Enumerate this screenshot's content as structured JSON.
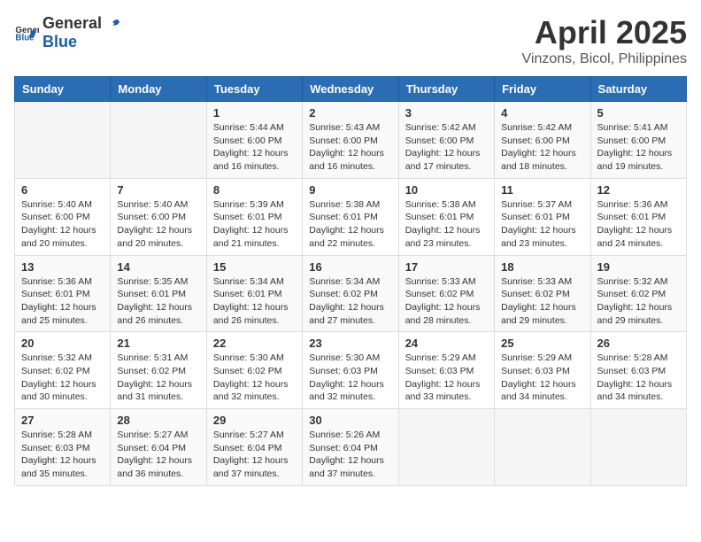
{
  "logo": {
    "general": "General",
    "blue": "Blue"
  },
  "title": {
    "month_year": "April 2025",
    "location": "Vinzons, Bicol, Philippines"
  },
  "headers": [
    "Sunday",
    "Monday",
    "Tuesday",
    "Wednesday",
    "Thursday",
    "Friday",
    "Saturday"
  ],
  "weeks": [
    [
      {
        "day": "",
        "info": ""
      },
      {
        "day": "",
        "info": ""
      },
      {
        "day": "1",
        "info": "Sunrise: 5:44 AM\nSunset: 6:00 PM\nDaylight: 12 hours and 16 minutes."
      },
      {
        "day": "2",
        "info": "Sunrise: 5:43 AM\nSunset: 6:00 PM\nDaylight: 12 hours and 16 minutes."
      },
      {
        "day": "3",
        "info": "Sunrise: 5:42 AM\nSunset: 6:00 PM\nDaylight: 12 hours and 17 minutes."
      },
      {
        "day": "4",
        "info": "Sunrise: 5:42 AM\nSunset: 6:00 PM\nDaylight: 12 hours and 18 minutes."
      },
      {
        "day": "5",
        "info": "Sunrise: 5:41 AM\nSunset: 6:00 PM\nDaylight: 12 hours and 19 minutes."
      }
    ],
    [
      {
        "day": "6",
        "info": "Sunrise: 5:40 AM\nSunset: 6:00 PM\nDaylight: 12 hours and 20 minutes."
      },
      {
        "day": "7",
        "info": "Sunrise: 5:40 AM\nSunset: 6:00 PM\nDaylight: 12 hours and 20 minutes."
      },
      {
        "day": "8",
        "info": "Sunrise: 5:39 AM\nSunset: 6:01 PM\nDaylight: 12 hours and 21 minutes."
      },
      {
        "day": "9",
        "info": "Sunrise: 5:38 AM\nSunset: 6:01 PM\nDaylight: 12 hours and 22 minutes."
      },
      {
        "day": "10",
        "info": "Sunrise: 5:38 AM\nSunset: 6:01 PM\nDaylight: 12 hours and 23 minutes."
      },
      {
        "day": "11",
        "info": "Sunrise: 5:37 AM\nSunset: 6:01 PM\nDaylight: 12 hours and 23 minutes."
      },
      {
        "day": "12",
        "info": "Sunrise: 5:36 AM\nSunset: 6:01 PM\nDaylight: 12 hours and 24 minutes."
      }
    ],
    [
      {
        "day": "13",
        "info": "Sunrise: 5:36 AM\nSunset: 6:01 PM\nDaylight: 12 hours and 25 minutes."
      },
      {
        "day": "14",
        "info": "Sunrise: 5:35 AM\nSunset: 6:01 PM\nDaylight: 12 hours and 26 minutes."
      },
      {
        "day": "15",
        "info": "Sunrise: 5:34 AM\nSunset: 6:01 PM\nDaylight: 12 hours and 26 minutes."
      },
      {
        "day": "16",
        "info": "Sunrise: 5:34 AM\nSunset: 6:02 PM\nDaylight: 12 hours and 27 minutes."
      },
      {
        "day": "17",
        "info": "Sunrise: 5:33 AM\nSunset: 6:02 PM\nDaylight: 12 hours and 28 minutes."
      },
      {
        "day": "18",
        "info": "Sunrise: 5:33 AM\nSunset: 6:02 PM\nDaylight: 12 hours and 29 minutes."
      },
      {
        "day": "19",
        "info": "Sunrise: 5:32 AM\nSunset: 6:02 PM\nDaylight: 12 hours and 29 minutes."
      }
    ],
    [
      {
        "day": "20",
        "info": "Sunrise: 5:32 AM\nSunset: 6:02 PM\nDaylight: 12 hours and 30 minutes."
      },
      {
        "day": "21",
        "info": "Sunrise: 5:31 AM\nSunset: 6:02 PM\nDaylight: 12 hours and 31 minutes."
      },
      {
        "day": "22",
        "info": "Sunrise: 5:30 AM\nSunset: 6:02 PM\nDaylight: 12 hours and 32 minutes."
      },
      {
        "day": "23",
        "info": "Sunrise: 5:30 AM\nSunset: 6:03 PM\nDaylight: 12 hours and 32 minutes."
      },
      {
        "day": "24",
        "info": "Sunrise: 5:29 AM\nSunset: 6:03 PM\nDaylight: 12 hours and 33 minutes."
      },
      {
        "day": "25",
        "info": "Sunrise: 5:29 AM\nSunset: 6:03 PM\nDaylight: 12 hours and 34 minutes."
      },
      {
        "day": "26",
        "info": "Sunrise: 5:28 AM\nSunset: 6:03 PM\nDaylight: 12 hours and 34 minutes."
      }
    ],
    [
      {
        "day": "27",
        "info": "Sunrise: 5:28 AM\nSunset: 6:03 PM\nDaylight: 12 hours and 35 minutes."
      },
      {
        "day": "28",
        "info": "Sunrise: 5:27 AM\nSunset: 6:04 PM\nDaylight: 12 hours and 36 minutes."
      },
      {
        "day": "29",
        "info": "Sunrise: 5:27 AM\nSunset: 6:04 PM\nDaylight: 12 hours and 37 minutes."
      },
      {
        "day": "30",
        "info": "Sunrise: 5:26 AM\nSunset: 6:04 PM\nDaylight: 12 hours and 37 minutes."
      },
      {
        "day": "",
        "info": ""
      },
      {
        "day": "",
        "info": ""
      },
      {
        "day": "",
        "info": ""
      }
    ]
  ]
}
